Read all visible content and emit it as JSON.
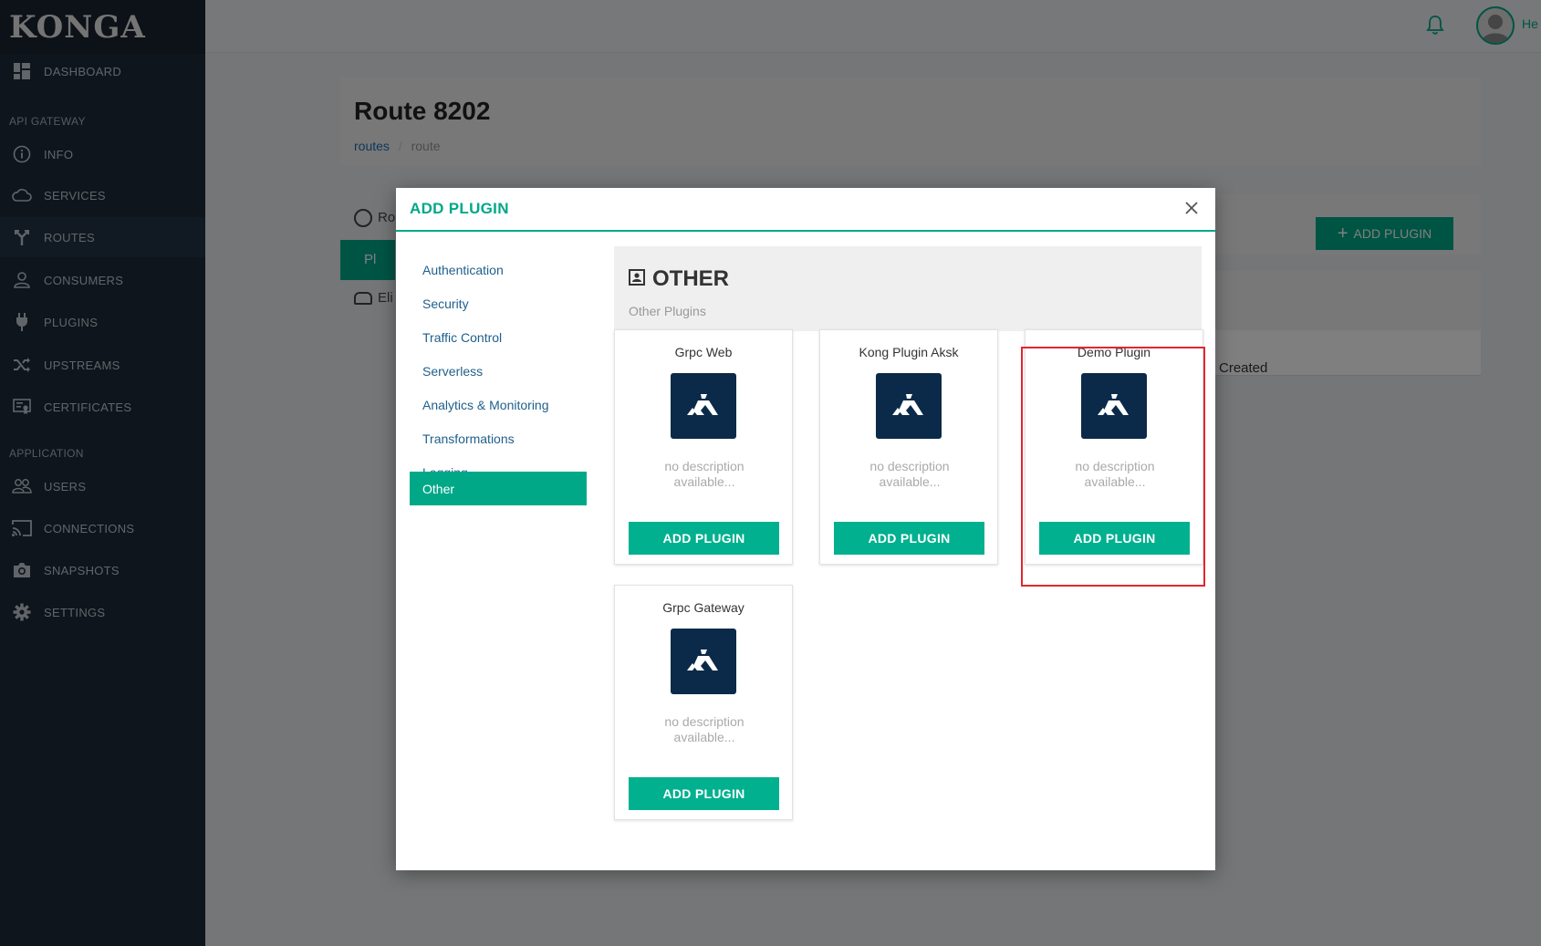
{
  "app": {
    "logo": "KONGA"
  },
  "sidebar": {
    "dashboard": "DASHBOARD",
    "section_api": "API GATEWAY",
    "items_api": [
      "INFO",
      "SERVICES",
      "ROUTES",
      "CONSUMERS",
      "PLUGINS",
      "UPSTREAMS",
      "CERTIFICATES"
    ],
    "section_app": "APPLICATION",
    "items_app": [
      "USERS",
      "CONNECTIONS",
      "SNAPSHOTS",
      "SETTINGS"
    ],
    "active": "ROUTES"
  },
  "topbar": {
    "user_name": "He"
  },
  "page": {
    "title": "Route 8202",
    "breadcrumb_link": "routes",
    "breadcrumb_sep": "/",
    "breadcrumb_current": "route",
    "tab_route": "Ro",
    "tab_plugins": "Pl",
    "tab_eligible": "Eli",
    "add_plugin_button": "ADD PLUGIN",
    "column_created": "Created"
  },
  "modal": {
    "title": "ADD PLUGIN",
    "categories": [
      "Authentication",
      "Security",
      "Traffic Control",
      "Serverless",
      "Analytics & Monitoring",
      "Transformations",
      "Logging",
      "Other"
    ],
    "active_category": "Other",
    "section_title": "OTHER",
    "section_subtitle": "Other Plugins",
    "plugins": [
      {
        "name": "Grpc Web",
        "description": "no description available...",
        "button": "ADD PLUGIN"
      },
      {
        "name": "Kong Plugin Aksk",
        "description": "no description available...",
        "button": "ADD PLUGIN"
      },
      {
        "name": "Demo Plugin",
        "description": "no description available...",
        "button": "ADD PLUGIN"
      },
      {
        "name": "Grpc Gateway",
        "description": "no description available...",
        "button": "ADD PLUGIN"
      }
    ]
  },
  "colors": {
    "accent": "#00a888",
    "sidebar_bg": "#1d2b38",
    "highlight": "#e3262e",
    "plugin_logo_bg": "#0b2a4a"
  }
}
